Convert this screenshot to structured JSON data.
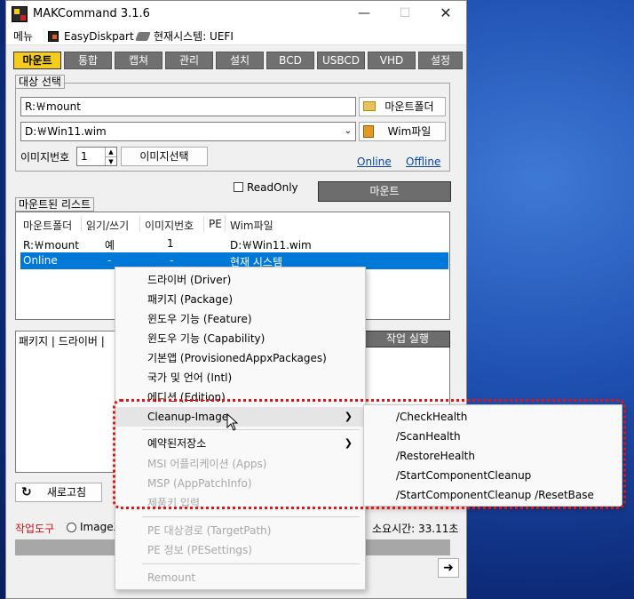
{
  "window": {
    "title": "MAKCommand 3.1.6"
  },
  "menubar": {
    "menu": "메뉴",
    "diskpart": "EasyDiskpart",
    "system": "현재시스템: UEFI"
  },
  "tabs": [
    "마운트",
    "통합",
    "캡쳐",
    "관리",
    "설치",
    "BCD",
    "USBCD",
    "VHD",
    "설정"
  ],
  "target": {
    "group_label": "대상 선택",
    "mount_path": "R:￦mount",
    "mount_folder_btn": "마운트폴더",
    "wim_path": "D:￦Win11.wim",
    "wim_btn": "Wim파일",
    "image_no_label": "이미지번호",
    "image_no": "1",
    "image_select_btn": "이미지선택",
    "online_link": "Online",
    "offline_link": "Offline"
  },
  "readonly_label": "ReadOnly",
  "mount_btn": "마운트",
  "mounted": {
    "group_label": "마운트된 리스트",
    "columns": [
      "마운트폴더",
      "읽기/쓰기",
      "이미지번호",
      "PE",
      "Wim파일"
    ],
    "rows": [
      [
        "R:￦mount",
        "예",
        "1",
        "",
        "D:￦Win11.wim"
      ],
      [
        "Online",
        "-",
        "-",
        "",
        "현재 시스템"
      ]
    ]
  },
  "lower": {
    "tabs_label": "패키지 | 드라이버 |",
    "run_btn": "작업 실행",
    "refresh_btn": "새로고침"
  },
  "footer": {
    "tools_label": "작업도구",
    "radio_label": "ImageX",
    "elapsed": "소요시간: 33.11초"
  },
  "context_menu": {
    "items": [
      {
        "label": "드라이버 (Driver)"
      },
      {
        "label": "패키지 (Package)"
      },
      {
        "label": "윈도우 기능 (Feature)"
      },
      {
        "label": "윈도우 기능 (Capability)"
      },
      {
        "label": "기본앱 (ProvisionedAppxPackages)"
      },
      {
        "label": "국가 및 언어 (Intl)"
      },
      {
        "label": "에디션 (Edition)"
      },
      {
        "label": "Cleanup-Image"
      },
      {
        "label": "예약된저장소"
      },
      {
        "label": "MSI 어플리케이션 (Apps)"
      },
      {
        "label": "MSP (AppPatchInfo)"
      },
      {
        "label": "제품키 입력"
      },
      {
        "label": "PE 대상경로 (TargetPath)"
      },
      {
        "label": "PE 정보 (PESettings)"
      },
      {
        "label": "Remount"
      }
    ]
  },
  "submenu": {
    "items": [
      "/CheckHealth",
      "/ScanHealth",
      "/RestoreHealth",
      "/StartComponentCleanup",
      "/StartComponentCleanup /ResetBase"
    ]
  },
  "colors": {
    "tab_active": "#f5cc1c",
    "tab_inactive": "#707070",
    "selection": "#0078d7",
    "highlight_border": "#e01616"
  }
}
